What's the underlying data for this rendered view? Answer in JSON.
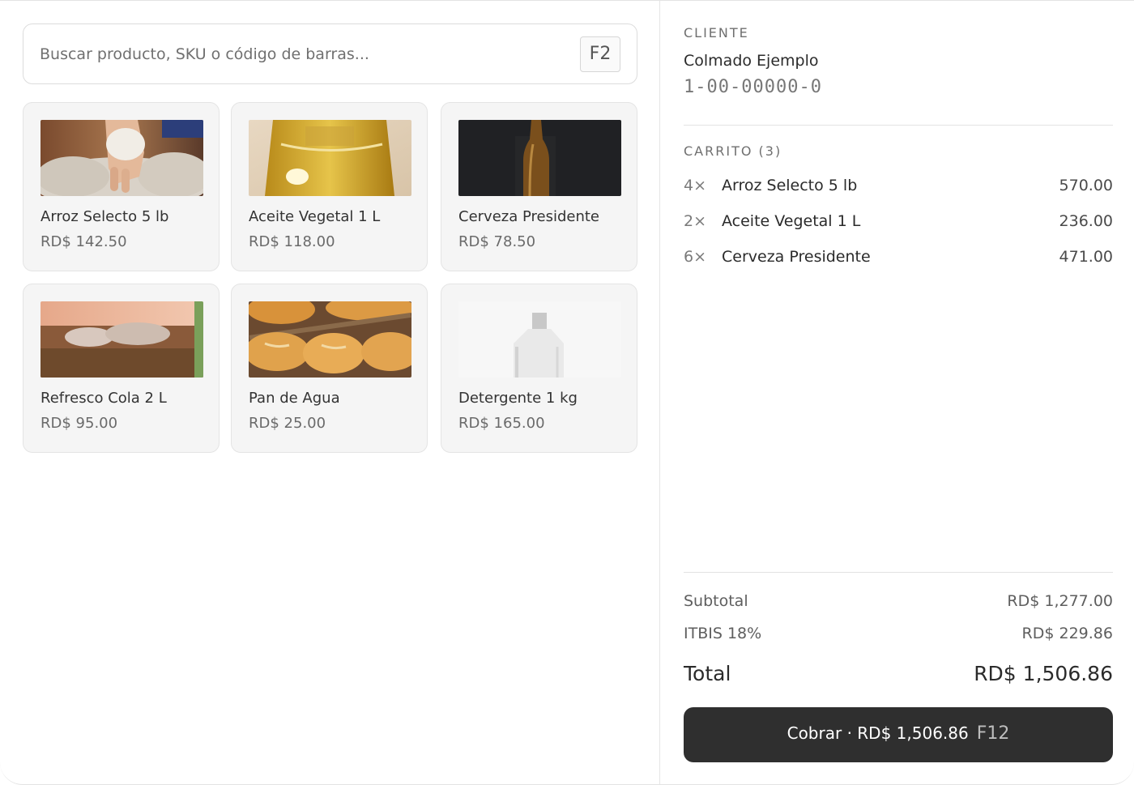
{
  "search": {
    "placeholder": "Buscar producto, SKU o código de barras...",
    "shortcut": "F2"
  },
  "products": [
    {
      "name": "Arroz Selecto 5 lb",
      "price": "RD$ 142.50",
      "image": "rice-photo"
    },
    {
      "name": "Aceite Vegetal 1 L",
      "price": "RD$ 118.00",
      "image": "oil-bottle-photo"
    },
    {
      "name": "Cerveza Presidente",
      "price": "RD$ 78.50",
      "image": "beer-bottle-photo"
    },
    {
      "name": "Refresco Cola 2 L",
      "price": "RD$ 95.00",
      "image": "cola-glass-photo"
    },
    {
      "name": "Pan de Agua",
      "price": "RD$ 25.00",
      "image": "bread-photo"
    },
    {
      "name": "Detergente 1 kg",
      "price": "RD$ 165.00",
      "image": "detergent-bottle-photo"
    }
  ],
  "customer": {
    "label": "CLIENTE",
    "name": "Colmado Ejemplo",
    "rnc": "1-00-00000-0"
  },
  "cart": {
    "label": "CARRITO (3)",
    "items": [
      {
        "qty": "4×",
        "name": "Arroz Selecto 5 lb",
        "amount": "570.00"
      },
      {
        "qty": "2×",
        "name": "Aceite Vegetal 1 L",
        "amount": "236.00"
      },
      {
        "qty": "6×",
        "name": "Cerveza Presidente",
        "amount": "471.00"
      }
    ]
  },
  "totals": {
    "subtotal_label": "Subtotal",
    "subtotal": "RD$ 1,277.00",
    "tax_label": "ITBIS 18%",
    "tax": "RD$ 229.86",
    "total_label": "Total",
    "total": "RD$ 1,506.86"
  },
  "pay_button": {
    "label": "Cobrar · RD$ 1,506.86",
    "shortcut": "F12"
  },
  "colors": {
    "button": "#2f2f2f",
    "card": "#f5f5f5",
    "text": "#2b2b2b"
  }
}
